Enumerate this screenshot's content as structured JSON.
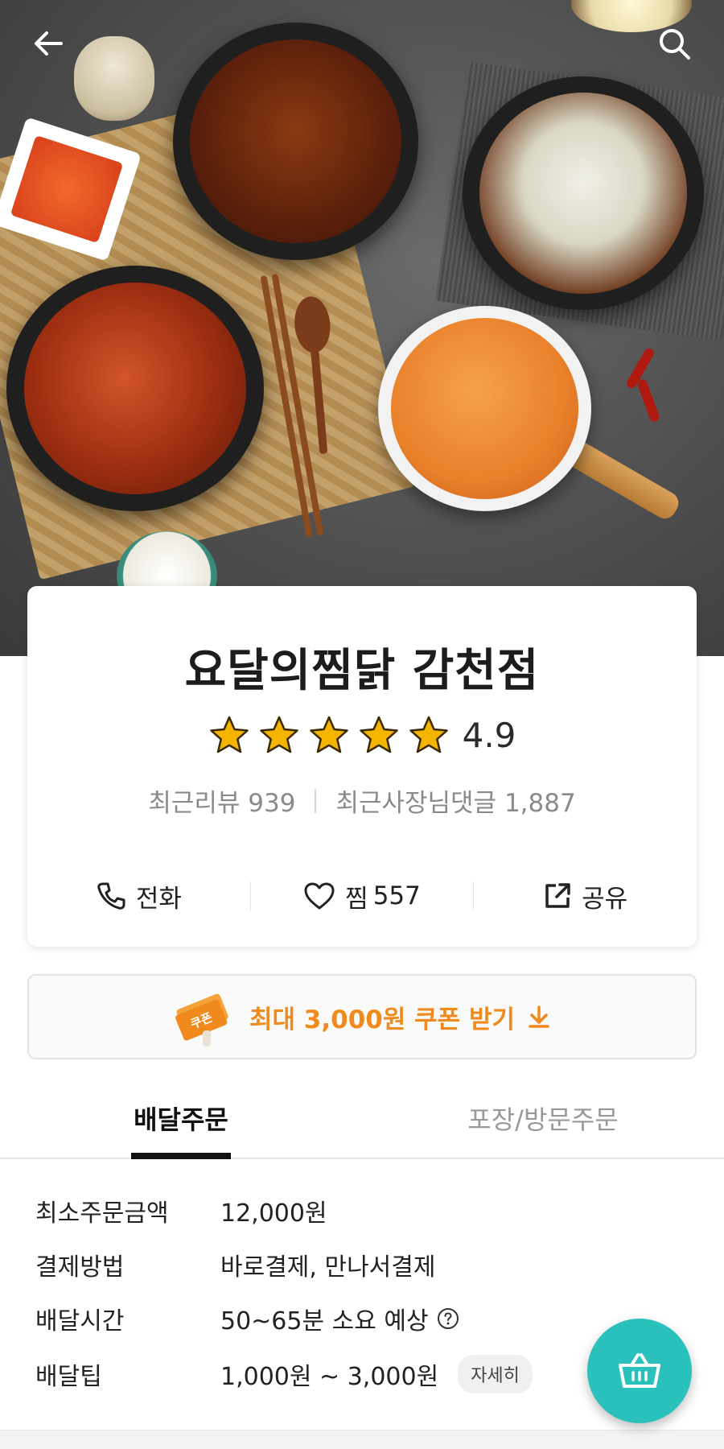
{
  "header": {
    "back_icon": "arrow-left-icon",
    "search_icon": "search-icon"
  },
  "store": {
    "name": "요달의찜닭 감천점",
    "rating": "4.9",
    "stars_filled": 5,
    "recent_reviews_label": "최근리뷰",
    "recent_reviews_count": "939",
    "owner_replies_label": "최근사장님댓글",
    "owner_replies_count": "1,887"
  },
  "actions": {
    "call_label": "전화",
    "call_icon": "phone-icon",
    "like_label": "찜",
    "like_count": "557",
    "like_icon": "heart-icon",
    "share_label": "공유",
    "share_icon": "share-icon"
  },
  "coupon": {
    "badge_text": "쿠폰",
    "label": "최대 3,000원 쿠폰 받기",
    "icon": "download-icon"
  },
  "tabs": [
    {
      "label": "배달주문",
      "active": true
    },
    {
      "label": "포장/방문주문",
      "active": false
    }
  ],
  "delivery_info": {
    "min_order_label": "최소주문금액",
    "min_order_value": "12,000원",
    "payment_label": "결제방법",
    "payment_value": "바로결제, 만나서결제",
    "time_label": "배달시간",
    "time_value": "50~65분 소요 예상",
    "tip_label": "배달팁",
    "tip_value": "1,000원 ~ 3,000원",
    "detail_button": "자세히"
  },
  "colors": {
    "accent_orange": "#f08a1c",
    "cart_teal": "#2ac1bc",
    "star_gold": "#f5b400"
  },
  "cart": {
    "icon": "basket-icon"
  }
}
